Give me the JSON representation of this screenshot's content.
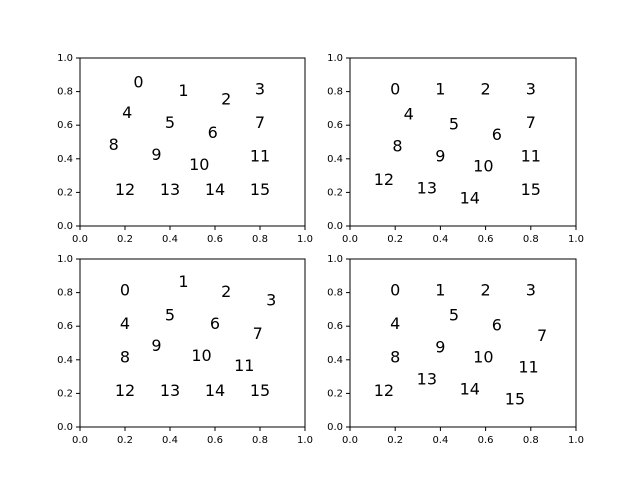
{
  "chart_data": [
    {
      "type": "scatter",
      "title": "",
      "xlabel": "",
      "ylabel": "",
      "xlim": [
        0.0,
        1.0
      ],
      "ylim": [
        0.0,
        1.0
      ],
      "xticks": [
        "0.0",
        "0.2",
        "0.4",
        "0.6",
        "0.8",
        "1.0"
      ],
      "yticks": [
        "0.0",
        "0.2",
        "0.4",
        "0.6",
        "0.8",
        "1.0"
      ],
      "grid": false,
      "points": [
        {
          "label": "0",
          "x": 0.26,
          "y": 0.85
        },
        {
          "label": "1",
          "x": 0.46,
          "y": 0.8
        },
        {
          "label": "2",
          "x": 0.65,
          "y": 0.75
        },
        {
          "label": "3",
          "x": 0.8,
          "y": 0.81
        },
        {
          "label": "4",
          "x": 0.21,
          "y": 0.67
        },
        {
          "label": "5",
          "x": 0.4,
          "y": 0.61
        },
        {
          "label": "6",
          "x": 0.59,
          "y": 0.55
        },
        {
          "label": "7",
          "x": 0.8,
          "y": 0.61
        },
        {
          "label": "8",
          "x": 0.15,
          "y": 0.48
        },
        {
          "label": "9",
          "x": 0.34,
          "y": 0.42
        },
        {
          "label": "10",
          "x": 0.53,
          "y": 0.36
        },
        {
          "label": "11",
          "x": 0.8,
          "y": 0.41
        },
        {
          "label": "12",
          "x": 0.2,
          "y": 0.21
        },
        {
          "label": "13",
          "x": 0.4,
          "y": 0.21
        },
        {
          "label": "14",
          "x": 0.6,
          "y": 0.21
        },
        {
          "label": "15",
          "x": 0.8,
          "y": 0.21
        }
      ]
    },
    {
      "type": "scatter",
      "title": "",
      "xlabel": "",
      "ylabel": "",
      "xlim": [
        0.0,
        1.0
      ],
      "ylim": [
        0.0,
        1.0
      ],
      "xticks": [
        "0.0",
        "0.2",
        "0.4",
        "0.6",
        "0.8",
        "1.0"
      ],
      "yticks": [
        "0.0",
        "0.2",
        "0.4",
        "0.6",
        "0.8",
        "1.0"
      ],
      "grid": false,
      "points": [
        {
          "label": "0",
          "x": 0.2,
          "y": 0.81
        },
        {
          "label": "1",
          "x": 0.4,
          "y": 0.81
        },
        {
          "label": "2",
          "x": 0.6,
          "y": 0.81
        },
        {
          "label": "3",
          "x": 0.8,
          "y": 0.81
        },
        {
          "label": "4",
          "x": 0.26,
          "y": 0.66
        },
        {
          "label": "5",
          "x": 0.46,
          "y": 0.6
        },
        {
          "label": "6",
          "x": 0.65,
          "y": 0.54
        },
        {
          "label": "7",
          "x": 0.8,
          "y": 0.61
        },
        {
          "label": "8",
          "x": 0.21,
          "y": 0.47
        },
        {
          "label": "9",
          "x": 0.4,
          "y": 0.41
        },
        {
          "label": "10",
          "x": 0.59,
          "y": 0.35
        },
        {
          "label": "11",
          "x": 0.8,
          "y": 0.41
        },
        {
          "label": "12",
          "x": 0.15,
          "y": 0.27
        },
        {
          "label": "13",
          "x": 0.34,
          "y": 0.22
        },
        {
          "label": "14",
          "x": 0.53,
          "y": 0.16
        },
        {
          "label": "15",
          "x": 0.8,
          "y": 0.21
        }
      ]
    },
    {
      "type": "scatter",
      "title": "",
      "xlabel": "",
      "ylabel": "",
      "xlim": [
        0.0,
        1.0
      ],
      "ylim": [
        0.0,
        1.0
      ],
      "xticks": [
        "0.0",
        "0.2",
        "0.4",
        "0.6",
        "0.8",
        "1.0"
      ],
      "yticks": [
        "0.0",
        "0.2",
        "0.4",
        "0.6",
        "0.8",
        "1.0"
      ],
      "grid": false,
      "points": [
        {
          "label": "0",
          "x": 0.2,
          "y": 0.81
        },
        {
          "label": "1",
          "x": 0.46,
          "y": 0.86
        },
        {
          "label": "2",
          "x": 0.65,
          "y": 0.8
        },
        {
          "label": "3",
          "x": 0.85,
          "y": 0.75
        },
        {
          "label": "4",
          "x": 0.2,
          "y": 0.61
        },
        {
          "label": "5",
          "x": 0.4,
          "y": 0.66
        },
        {
          "label": "6",
          "x": 0.6,
          "y": 0.61
        },
        {
          "label": "7",
          "x": 0.79,
          "y": 0.55
        },
        {
          "label": "8",
          "x": 0.2,
          "y": 0.41
        },
        {
          "label": "9",
          "x": 0.34,
          "y": 0.48
        },
        {
          "label": "10",
          "x": 0.54,
          "y": 0.42
        },
        {
          "label": "11",
          "x": 0.73,
          "y": 0.36
        },
        {
          "label": "12",
          "x": 0.2,
          "y": 0.21
        },
        {
          "label": "13",
          "x": 0.4,
          "y": 0.21
        },
        {
          "label": "14",
          "x": 0.6,
          "y": 0.21
        },
        {
          "label": "15",
          "x": 0.8,
          "y": 0.21
        }
      ]
    },
    {
      "type": "scatter",
      "title": "",
      "xlabel": "",
      "ylabel": "",
      "xlim": [
        0.0,
        1.0
      ],
      "ylim": [
        0.0,
        1.0
      ],
      "xticks": [
        "0.0",
        "0.2",
        "0.4",
        "0.6",
        "0.8",
        "1.0"
      ],
      "yticks": [
        "0.0",
        "0.2",
        "0.4",
        "0.6",
        "0.8",
        "1.0"
      ],
      "grid": false,
      "points": [
        {
          "label": "0",
          "x": 0.2,
          "y": 0.81
        },
        {
          "label": "1",
          "x": 0.4,
          "y": 0.81
        },
        {
          "label": "2",
          "x": 0.6,
          "y": 0.81
        },
        {
          "label": "3",
          "x": 0.8,
          "y": 0.81
        },
        {
          "label": "4",
          "x": 0.2,
          "y": 0.61
        },
        {
          "label": "5",
          "x": 0.46,
          "y": 0.66
        },
        {
          "label": "6",
          "x": 0.65,
          "y": 0.6
        },
        {
          "label": "7",
          "x": 0.85,
          "y": 0.54
        },
        {
          "label": "8",
          "x": 0.2,
          "y": 0.41
        },
        {
          "label": "9",
          "x": 0.4,
          "y": 0.47
        },
        {
          "label": "10",
          "x": 0.59,
          "y": 0.41
        },
        {
          "label": "11",
          "x": 0.79,
          "y": 0.35
        },
        {
          "label": "12",
          "x": 0.15,
          "y": 0.21
        },
        {
          "label": "13",
          "x": 0.34,
          "y": 0.28
        },
        {
          "label": "14",
          "x": 0.53,
          "y": 0.22
        },
        {
          "label": "15",
          "x": 0.73,
          "y": 0.16
        }
      ]
    }
  ]
}
